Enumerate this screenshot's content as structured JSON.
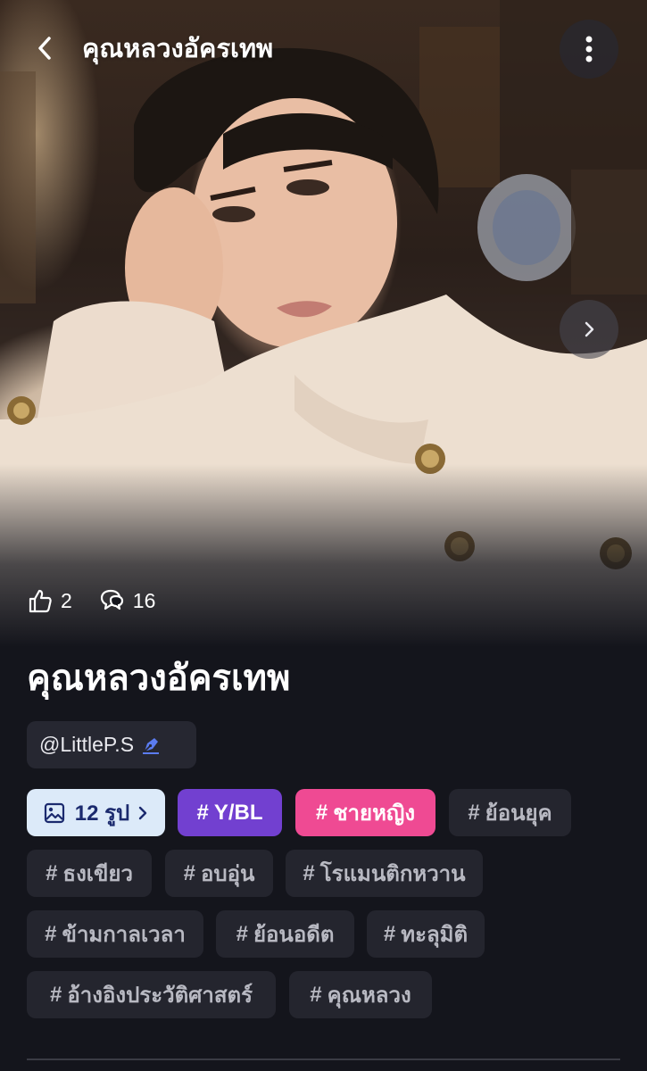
{
  "header": {
    "title": "คุณหลวงอัครเทพ"
  },
  "stats": {
    "likes": "2",
    "comments": "16"
  },
  "story": {
    "title": "คุณหลวงอัครเทพ",
    "author": "@LittleP.S"
  },
  "gallery": {
    "label": "12 รูป"
  },
  "tags": {
    "hash": "#",
    "items": [
      "Y/BL",
      "ชายหญิง",
      "ย้อนยุค",
      "ธงเขียว",
      "อบอุ่น",
      "โรแมนติกหวาน",
      "ข้ามกาลเวลา",
      "ย้อนอดีต",
      "ทะลุมิติ",
      "อ้างอิงประวัติศาสตร์",
      "คุณหลวง"
    ]
  },
  "colors": {
    "background": "#14151c",
    "chip": "#24252e",
    "gallery_chip": "#dceaf9",
    "purple_tag": "#7240d0",
    "pink_tag": "#ef4a93",
    "pen_icon": "#5b7cf0"
  },
  "icons": [
    "back-arrow-icon",
    "more-vertical-icon",
    "chevron-right-icon",
    "thumbs-up-icon",
    "comment-icon",
    "pen-icon",
    "image-icon"
  ]
}
